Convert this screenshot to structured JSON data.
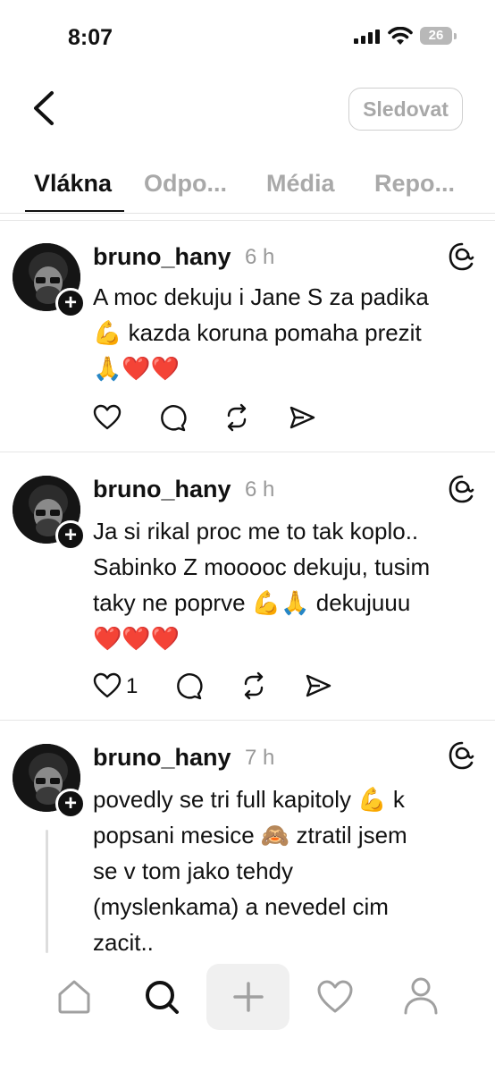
{
  "status_bar": {
    "time": "8:07",
    "battery": "26"
  },
  "header": {
    "follow_label": "Sledovat"
  },
  "tabs": [
    "Vlákna",
    "Odpo...",
    "Média",
    "Repo..."
  ],
  "posts": [
    {
      "username": "bruno_hany",
      "time": "6 h",
      "lines": [
        "A moc dekuju i Jane S za padika",
        "💪 kazda koruna pomaha prezit",
        "🙏❤️❤️"
      ],
      "likes": ""
    },
    {
      "username": "bruno_hany",
      "time": "6 h",
      "lines": [
        "Ja si rikal proc me to tak koplo..",
        "Sabinko Z mooooc dekuju, tusim",
        "taky ne poprve 💪🙏 dekujuuu",
        "❤️❤️❤️"
      ],
      "likes": "1"
    },
    {
      "username": "bruno_hany",
      "time": "7 h",
      "lines": [
        "povedly se tri full kapitoly 💪 k",
        "popsani mesice 🙈 ztratil jsem",
        "se v tom jako tehdy",
        "(myslenkama) a nevedel cim",
        "zacit.."
      ],
      "likes": ""
    }
  ],
  "icons": {
    "back": "chevron-left-icon",
    "threads": "threads-logo-icon",
    "like": "heart-icon",
    "reply": "comment-icon",
    "repost": "repost-icon",
    "share": "send-icon",
    "nav": [
      "home-icon",
      "search-icon",
      "create-icon",
      "activity-icon",
      "profile-icon"
    ]
  }
}
